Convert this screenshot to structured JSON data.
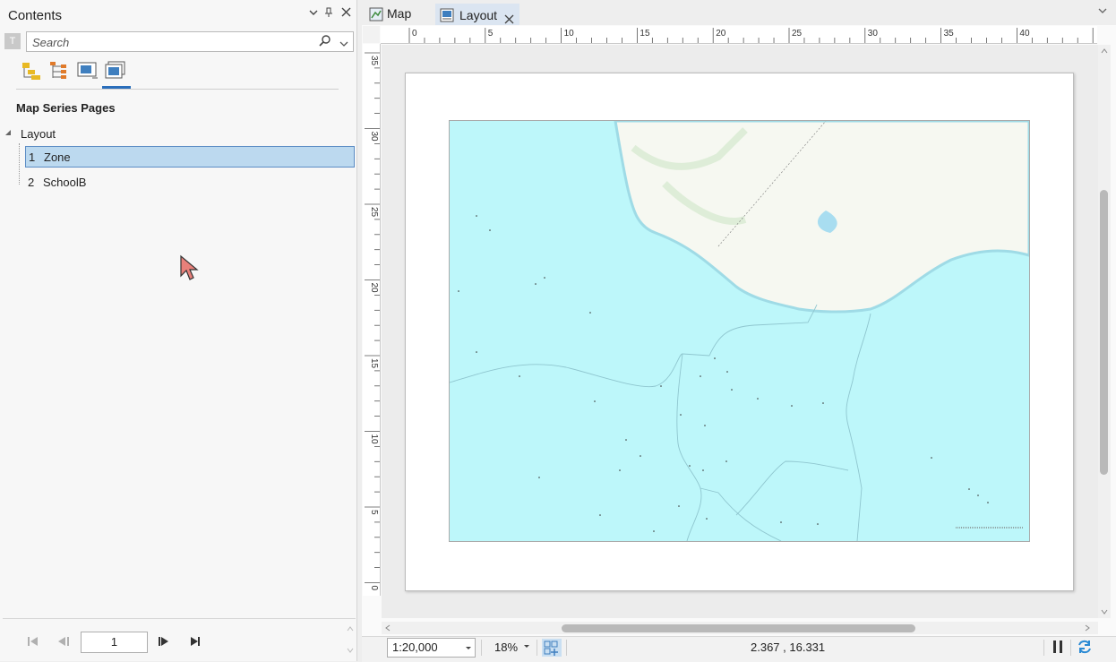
{
  "contents_pane": {
    "title": "Contents",
    "search_placeholder": "Search",
    "section_title": "Map Series Pages",
    "tree_root": "Layout",
    "pages": [
      {
        "number": "1",
        "name": "Zone",
        "selected": true
      },
      {
        "number": "2",
        "name": "SchoolB",
        "selected": false
      }
    ],
    "current_page": "1"
  },
  "tabs": [
    {
      "label": "Map",
      "active": false
    },
    {
      "label": "Layout",
      "active": true
    }
  ],
  "ruler": {
    "top_labels": [
      "0",
      "5",
      "10",
      "15",
      "20",
      "25",
      "30",
      "35",
      "40"
    ],
    "left_labels": [
      "35",
      "30",
      "25",
      "20",
      "15",
      "10",
      "5",
      "0"
    ]
  },
  "status": {
    "scale": "1:20,000",
    "zoom": "18%",
    "coordinates": "2.367 , 16.331"
  },
  "colors": {
    "water": "#bdf7fa",
    "land": "#f6f8f1",
    "accent": "#2a6ebb",
    "selection": "#bcd9ef"
  }
}
